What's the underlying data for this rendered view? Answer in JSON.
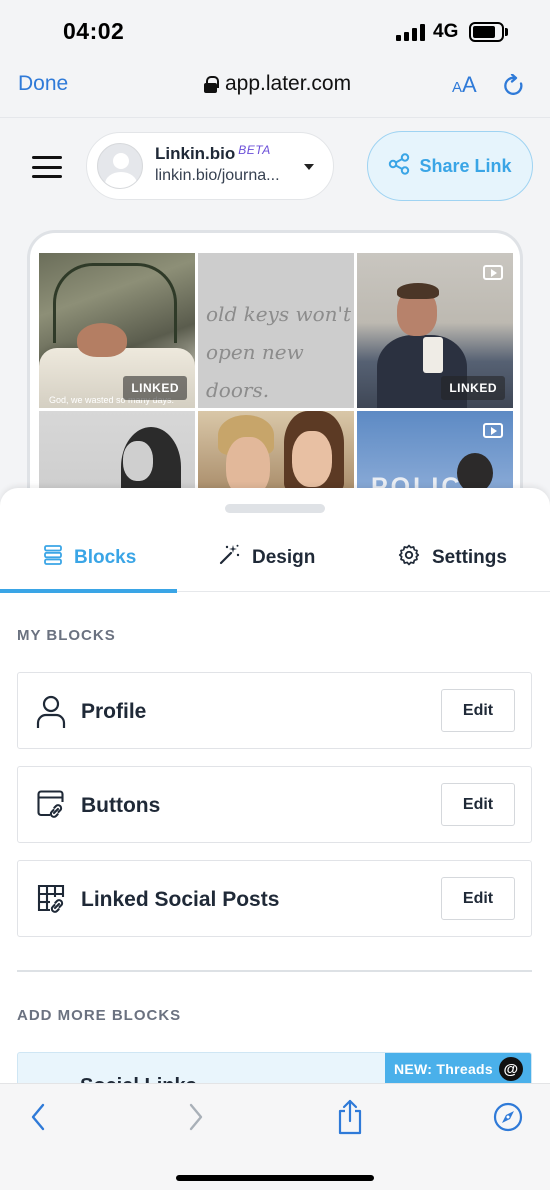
{
  "status_bar": {
    "time": "04:02",
    "network": "4G",
    "signal_bars": 4,
    "battery_level": 0.7
  },
  "safari": {
    "done_label": "Done",
    "url": "app.later.com",
    "text_size_label": "AA"
  },
  "header": {
    "brand": "Linkin.bio",
    "beta_label": "BETA",
    "profile_url": "linkin.bio/journa...",
    "share_label": "Share Link"
  },
  "preview": {
    "tiles": [
      {
        "badge": "LINKED",
        "caption": "God, we wasted so many days."
      },
      {
        "text_line1": "old keys won't",
        "text_line2": "open new doors."
      },
      {
        "badge": "LINKED"
      },
      {},
      {},
      {
        "text": "POLICE"
      }
    ]
  },
  "tabs": [
    {
      "label": "Blocks",
      "icon": "blocks-icon",
      "active": true
    },
    {
      "label": "Design",
      "icon": "magic-wand-icon",
      "active": false
    },
    {
      "label": "Settings",
      "icon": "gear-icon",
      "active": false
    }
  ],
  "my_blocks": {
    "heading": "MY BLOCKS",
    "items": [
      {
        "name": "Profile",
        "icon": "user-icon",
        "action": "Edit"
      },
      {
        "name": "Buttons",
        "icon": "link-window-icon",
        "action": "Edit"
      },
      {
        "name": "Linked Social Posts",
        "icon": "grid-link-icon",
        "action": "Edit"
      }
    ]
  },
  "add_more": {
    "heading": "ADD MORE BLOCKS",
    "promo_title": "Social Links",
    "new_badge": "NEW: Threads"
  },
  "colors": {
    "accent": "#3aa5e6",
    "ios_blue": "#2f7ad8",
    "beta": "#6b4fd8"
  }
}
